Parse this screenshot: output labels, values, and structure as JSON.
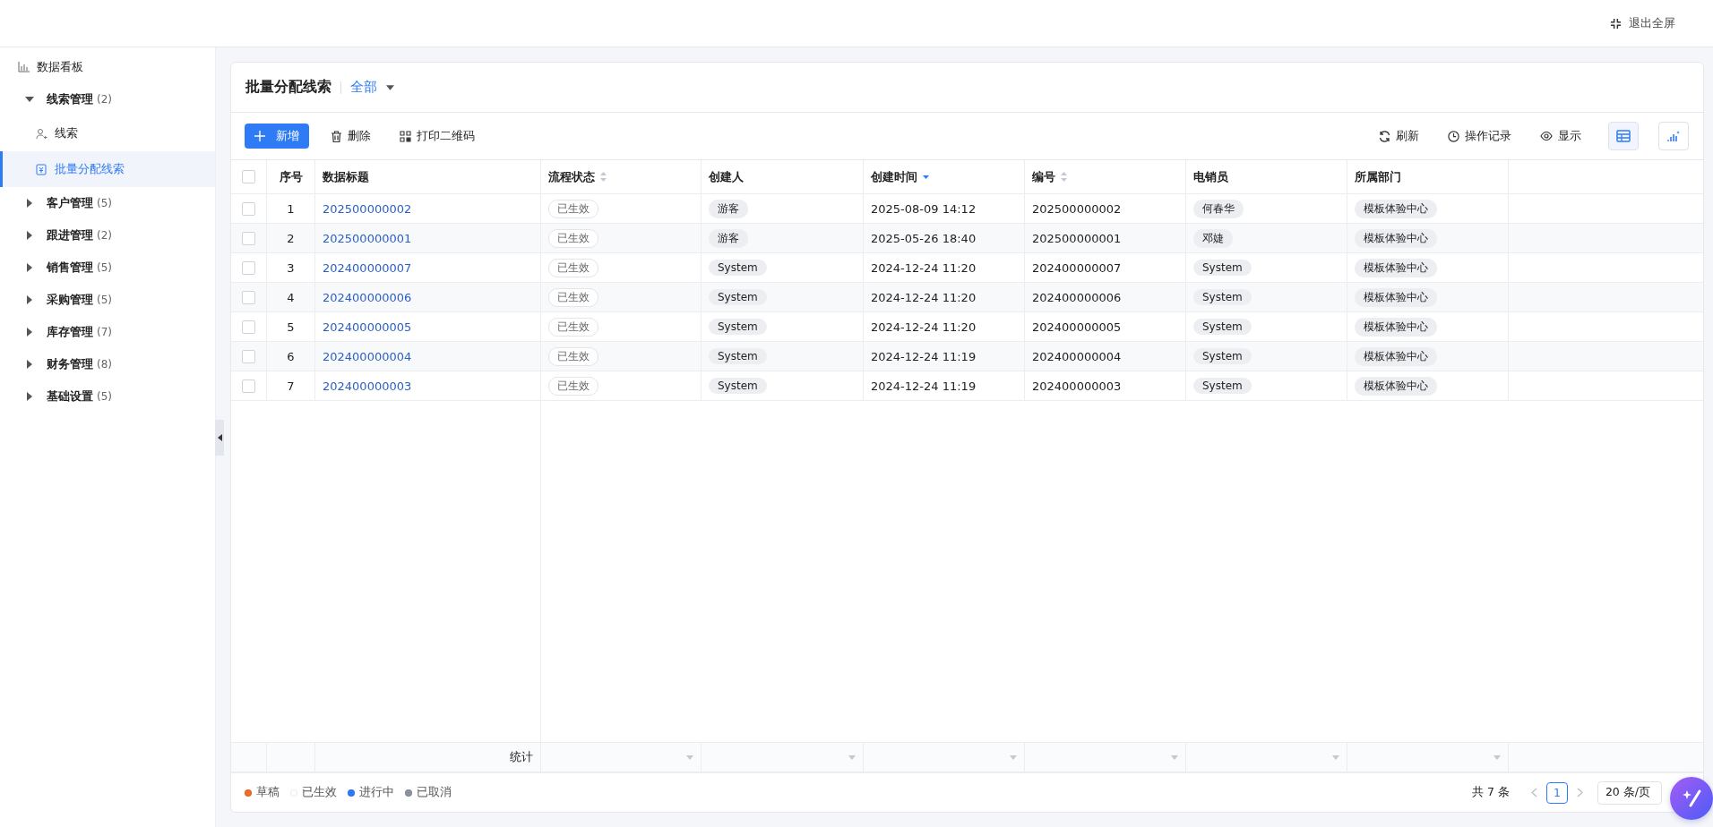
{
  "top_bar": {
    "exit_fullscreen": "退出全屏"
  },
  "sidebar": {
    "items": [
      {
        "label": "数据看板",
        "kind": "dashboard"
      },
      {
        "label": "线索管理",
        "count": "(2)",
        "kind": "group",
        "expanded": true,
        "children": [
          {
            "label": "线索",
            "kind": "contact",
            "selected": false
          },
          {
            "label": "批量分配线索",
            "kind": "assign",
            "selected": true
          }
        ]
      },
      {
        "label": "客户管理",
        "count": "(5)",
        "kind": "group",
        "expanded": false
      },
      {
        "label": "跟进管理",
        "count": "(2)",
        "kind": "group",
        "expanded": false
      },
      {
        "label": "销售管理",
        "count": "(5)",
        "kind": "group",
        "expanded": false
      },
      {
        "label": "采购管理",
        "count": "(5)",
        "kind": "group",
        "expanded": false
      },
      {
        "label": "库存管理",
        "count": "(7)",
        "kind": "group",
        "expanded": false
      },
      {
        "label": "财务管理",
        "count": "(8)",
        "kind": "group",
        "expanded": false
      },
      {
        "label": "基础设置",
        "count": "(5)",
        "kind": "group",
        "expanded": false
      }
    ]
  },
  "page": {
    "title": "批量分配线索",
    "filter": "全部"
  },
  "toolbar": {
    "left": [
      {
        "label": "新增",
        "kind": "add"
      },
      {
        "label": "删除",
        "kind": "delete"
      },
      {
        "label": "打印二维码",
        "kind": "qr"
      }
    ],
    "right": [
      {
        "label": "刷新",
        "kind": "refresh"
      },
      {
        "label": "操作记录",
        "kind": "history"
      },
      {
        "label": "显示",
        "kind": "eye"
      }
    ],
    "views": [
      {
        "kind": "table",
        "selected": true
      },
      {
        "kind": "chart",
        "selected": false
      }
    ]
  },
  "table": {
    "columns": [
      {
        "label": "序号",
        "sortable": false,
        "sorted": false
      },
      {
        "label": "数据标题",
        "sortable": false,
        "sorted": false
      },
      {
        "label": "流程状态",
        "sortable": true,
        "sorted": false
      },
      {
        "label": "创建人",
        "sortable": false,
        "sorted": false
      },
      {
        "label": "创建时间",
        "sortable": true,
        "sorted": true
      },
      {
        "label": "编号",
        "sortable": true,
        "sorted": false
      },
      {
        "label": "电销员",
        "sortable": false,
        "sorted": false
      },
      {
        "label": "所属部门",
        "sortable": false,
        "sorted": false
      }
    ],
    "all_checked": false,
    "rows": [
      {
        "index": "1",
        "title": "202500000002",
        "status": "已生效",
        "creator": "游客",
        "created": "2025-08-09 14:12",
        "number": "202500000002",
        "sales": "何春华",
        "dept": "模板体验中心",
        "checked": false
      },
      {
        "index": "2",
        "title": "202500000001",
        "status": "已生效",
        "creator": "游客",
        "created": "2025-05-26 18:40",
        "number": "202500000001",
        "sales": "邓婕",
        "dept": "模板体验中心",
        "checked": false
      },
      {
        "index": "3",
        "title": "202400000007",
        "status": "已生效",
        "creator": "System",
        "created": "2024-12-24 11:20",
        "number": "202400000007",
        "sales": "System",
        "dept": "模板体验中心",
        "checked": false
      },
      {
        "index": "4",
        "title": "202400000006",
        "status": "已生效",
        "creator": "System",
        "created": "2024-12-24 11:20",
        "number": "202400000006",
        "sales": "System",
        "dept": "模板体验中心",
        "checked": false
      },
      {
        "index": "5",
        "title": "202400000005",
        "status": "已生效",
        "creator": "System",
        "created": "2024-12-24 11:20",
        "number": "202400000005",
        "sales": "System",
        "dept": "模板体验中心",
        "checked": false
      },
      {
        "index": "6",
        "title": "202400000004",
        "status": "已生效",
        "creator": "System",
        "created": "2024-12-24 11:19",
        "number": "202400000004",
        "sales": "System",
        "dept": "模板体验中心",
        "checked": false
      },
      {
        "index": "7",
        "title": "202400000003",
        "status": "已生效",
        "creator": "System",
        "created": "2024-12-24 11:19",
        "number": "202400000003",
        "sales": "System",
        "dept": "模板体验中心",
        "checked": false
      }
    ],
    "summary_label": "统计"
  },
  "legend": [
    {
      "label": "草稿",
      "color": "#f26b27"
    },
    {
      "label": "已生效",
      "color": "#ffffff"
    },
    {
      "label": "进行中",
      "color": "#2f7bf5"
    },
    {
      "label": "已取消",
      "color": "#8a91a3"
    }
  ],
  "pagination": {
    "total": "共 7 条",
    "pages": [
      {
        "label": "1",
        "selected": true
      }
    ],
    "page_size": "20 条/页"
  }
}
